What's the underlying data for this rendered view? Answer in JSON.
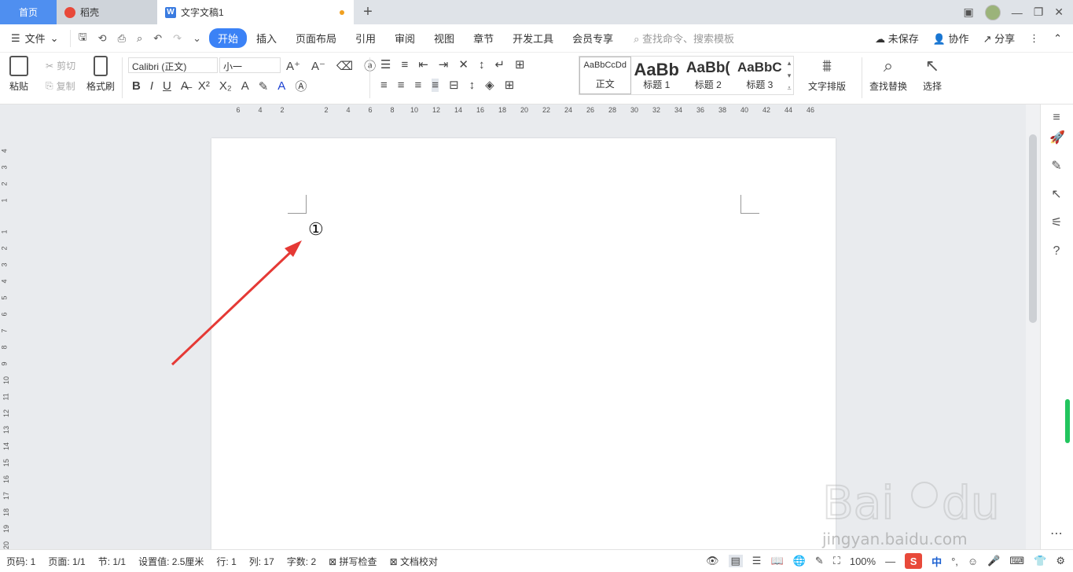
{
  "tabs": [
    {
      "label": "首页"
    },
    {
      "label": "稻壳"
    },
    {
      "label": "文字文稿1"
    }
  ],
  "menubar": {
    "file_label": "文件",
    "items": [
      "开始",
      "插入",
      "页面布局",
      "引用",
      "审阅",
      "视图",
      "章节",
      "开发工具",
      "会员专享"
    ],
    "search_placeholder": "查找命令、搜索模板",
    "unsaved": "未保存",
    "collab": "协作",
    "share": "分享"
  },
  "ribbon": {
    "paste": "粘贴",
    "cut": "剪切",
    "copy": "复制",
    "format_painter": "格式刷",
    "font_name": "Calibri (正文)",
    "font_size": "小一",
    "styles": [
      {
        "preview": "AaBbCcDd",
        "label": "正文"
      },
      {
        "preview": "AaBb",
        "label": "标题 1"
      },
      {
        "preview": "AaBb(",
        "label": "标题 2"
      },
      {
        "preview": "AaBbC",
        "label": "标题 3"
      }
    ],
    "text_layout": "文字排版",
    "find_replace": "查找替换",
    "select": "选择"
  },
  "ruler": {
    "h_ticks": [
      "6",
      "4",
      "2",
      "2",
      "4",
      "6",
      "8",
      "10",
      "12",
      "14",
      "16",
      "18",
      "20",
      "22",
      "24",
      "26",
      "28",
      "30",
      "32",
      "34",
      "36",
      "38",
      "40",
      "42",
      "44",
      "46"
    ],
    "v_ticks": [
      "4",
      "3",
      "2",
      "1",
      "1",
      "2",
      "3",
      "4",
      "5",
      "6",
      "7",
      "8",
      "9",
      "10",
      "11",
      "12",
      "13",
      "14",
      "15",
      "16",
      "17",
      "18",
      "19",
      "20"
    ]
  },
  "document": {
    "content": "①"
  },
  "status": {
    "page": "页码: 1",
    "pages": "页面: 1/1",
    "section": "节: 1/1",
    "setting": "设置值: 2.5厘米",
    "row": "行: 1",
    "col": "列: 17",
    "words": "字数: 2",
    "spell": "拼写检查",
    "proof": "文档校对",
    "zoom": "100%"
  },
  "watermark": {
    "text": "jingyan.baidu.com"
  },
  "colors": {
    "accent": "#3b82f6",
    "arrow": "#e53935",
    "ime": "#e8493a"
  }
}
